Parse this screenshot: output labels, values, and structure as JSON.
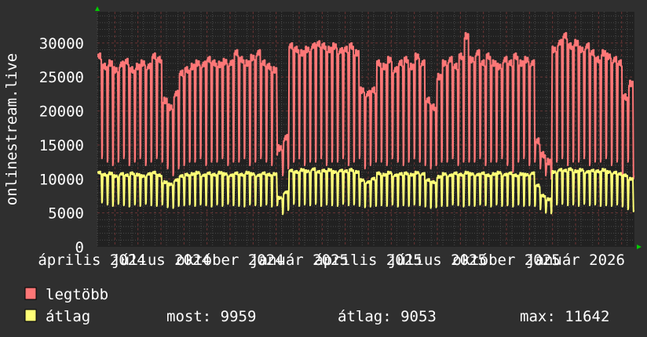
{
  "chart_data": {
    "type": "line",
    "ylabel": "onlinestream.live",
    "ylim": [
      0,
      34600
    ],
    "yticks": [
      "0",
      "5000",
      "10000",
      "15000",
      "20000",
      "25000",
      "30000"
    ],
    "xtick_labels": [
      "április 2024",
      "július 2024",
      "október 2024",
      "január 2025",
      "április 2025",
      "július 2025",
      "október 2025",
      "január 2026"
    ],
    "grid": true,
    "legend_placement": "bottom",
    "series": [
      {
        "name": "legtöbb",
        "color": "#ff7777",
        "weekday": [
          28000,
          26500,
          27000,
          26000,
          26800,
          27200,
          26000,
          26500,
          27000,
          26500,
          28000,
          27500,
          21500,
          20500,
          22500,
          25500,
          26000,
          26500,
          27000,
          26800,
          27500,
          27000,
          26800,
          27200,
          27000,
          28500,
          27500,
          27000,
          27800,
          28500,
          27000,
          26500,
          26000,
          14500,
          16000,
          29500,
          29000,
          28500,
          29000,
          29500,
          29800,
          29500,
          29000,
          29500,
          28800,
          29000,
          29500,
          28500,
          23000,
          22500,
          23000,
          27000,
          26500,
          27500,
          26000,
          27000,
          27500,
          26500,
          28000,
          27000,
          21500,
          20500,
          25000,
          27000,
          27500,
          26500,
          28000,
          31000,
          27500,
          28500,
          27000,
          28000,
          27000,
          26500,
          27500,
          27000,
          28000,
          27000,
          27500,
          27000,
          15500,
          13500,
          12500,
          29000,
          30000,
          31000,
          29500,
          30000,
          29000,
          29500,
          28500,
          27500,
          28500,
          28000,
          27500,
          27000,
          22000,
          24000
        ],
        "weekend": [
          13000,
          12500,
          12000,
          12500,
          13000,
          12000,
          12500,
          13000,
          12000,
          12500,
          13000,
          12500,
          11500,
          10500,
          11500,
          12000,
          12500,
          12500,
          13000,
          12000,
          12500,
          12500,
          13000,
          12000,
          12500,
          12500,
          13000,
          12000,
          12500,
          13000,
          12500,
          12000,
          13500,
          10500,
          11500,
          12500,
          13000,
          12000,
          12500,
          12500,
          13000,
          12000,
          12500,
          12500,
          13000,
          12000,
          12500,
          13000,
          11500,
          12000,
          12500,
          12500,
          12000,
          13000,
          12500,
          12000,
          12500,
          13000,
          12500,
          12000,
          11500,
          12000,
          12500,
          12500,
          13000,
          12000,
          12500,
          12500,
          12500,
          13000,
          12000,
          12500,
          12500,
          13000,
          12000,
          11000,
          12500,
          13000,
          12000,
          12500,
          11500,
          10500,
          10000,
          12500,
          13000,
          12000,
          12500,
          12500,
          13000,
          12000,
          12500,
          12500,
          13000,
          12000,
          12500,
          10000,
          12500,
          10000
        ]
      },
      {
        "name": "átlag",
        "color": "#ffff77",
        "weekday": [
          10900,
          10600,
          10800,
          10400,
          10700,
          10500,
          10800,
          10600,
          10400,
          10700,
          10900,
          10500,
          9500,
          9200,
          9800,
          10400,
          10600,
          10700,
          10900,
          10500,
          10800,
          10600,
          10900,
          10700,
          10500,
          10800,
          10600,
          10900,
          10700,
          10500,
          10800,
          10600,
          10700,
          7200,
          8000,
          11200,
          11000,
          11300,
          11100,
          11400,
          11000,
          11200,
          11300,
          11000,
          11200,
          11100,
          11300,
          11000,
          9800,
          9500,
          10000,
          10800,
          10600,
          10900,
          10500,
          10700,
          10800,
          10600,
          10900,
          10700,
          9800,
          9500,
          10300,
          10700,
          10500,
          10800,
          10600,
          10900,
          10700,
          10600,
          10800,
          10500,
          10700,
          10900,
          10600,
          10800,
          10500,
          10700,
          10600,
          10800,
          9000,
          7500,
          7000,
          11000,
          11300,
          11200,
          11400,
          11100,
          11300,
          11000,
          11200,
          11100,
          11300,
          11000,
          10900,
          10700,
          10500,
          10000
        ],
        "weekend": [
          6500,
          6200,
          6000,
          6300,
          6100,
          5900,
          6200,
          6000,
          6300,
          6100,
          6000,
          6200,
          5800,
          5700,
          6000,
          6100,
          6200,
          6000,
          6200,
          6100,
          5900,
          6200,
          6000,
          6300,
          6100,
          6000,
          5900,
          6200,
          6100,
          6000,
          6200,
          5900,
          6100,
          4800,
          5400,
          6300,
          6000,
          6200,
          6100,
          6300,
          6000,
          6200,
          6100,
          6000,
          6300,
          6100,
          6200,
          6000,
          5800,
          5900,
          6000,
          6100,
          6000,
          6200,
          5900,
          6100,
          6000,
          6200,
          6100,
          5900,
          5700,
          5800,
          6000,
          6000,
          6200,
          6100,
          5900,
          6100,
          6000,
          6200,
          6100,
          5900,
          6200,
          6000,
          6100,
          5900,
          6200,
          6000,
          6100,
          6000,
          5500,
          5000,
          4900,
          6200,
          6300,
          6100,
          6200,
          6000,
          6300,
          6100,
          6200,
          6000,
          6100,
          6000,
          6200,
          5900,
          5500,
          5200
        ]
      }
    ],
    "stats": {
      "most_label": "most:",
      "most": "9959",
      "atlag_label": "átlag:",
      "atlag": "9053",
      "max_label": "max:",
      "max": "11642"
    }
  },
  "colors": {
    "background": "#2f2f2f",
    "canvas": "#212121",
    "grid_minor": "#4a4a4a",
    "grid_major": "#6a3434",
    "arrow": "#00cc00"
  }
}
